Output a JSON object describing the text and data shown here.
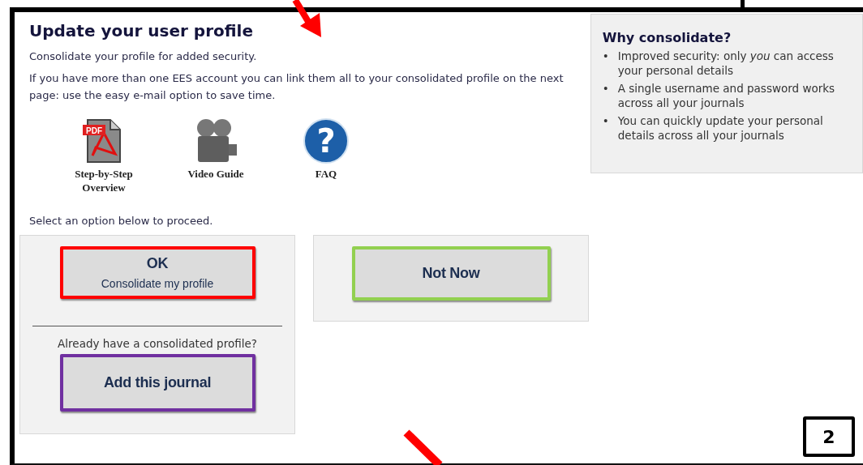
{
  "main": {
    "title": "Update your user profile",
    "intro": "Consolidate your profile for added security.",
    "details": "If you have more than one EES account you can link them all to your consolidated profile on the next page: use the easy e-mail option to save time.",
    "resources": [
      {
        "kind": "pdf",
        "label": "Step-by-Step Overview",
        "icon_text": "PDF"
      },
      {
        "kind": "video",
        "label": "Video Guide"
      },
      {
        "kind": "help",
        "label": "FAQ",
        "icon_text": "?"
      }
    ],
    "prompt": "Select an option below to proceed.",
    "consolidate_box": {
      "ok_button": {
        "label": "OK",
        "sublabel": "Consolidate my profile",
        "color": "#ff0000"
      },
      "question": "Already have a consolidated profile?",
      "add_button": {
        "label": "Add this journal",
        "color": "#7030a0"
      }
    },
    "skip_box": {
      "not_now_button": {
        "label": "Not Now",
        "color": "#92d050"
      }
    }
  },
  "sidebar": {
    "title": "Why consolidate?",
    "items": [
      {
        "bullet": "•",
        "text": "Improved security: only *you* can access your personal details"
      },
      {
        "bullet": "•",
        "text": "A single username and password works across all your journals"
      },
      {
        "bullet": "•",
        "text": "You can quickly update your personal details across all your journals"
      }
    ]
  },
  "annotations": {
    "top_arrow": true,
    "bottom_arrow": true,
    "step_badge": "2"
  }
}
